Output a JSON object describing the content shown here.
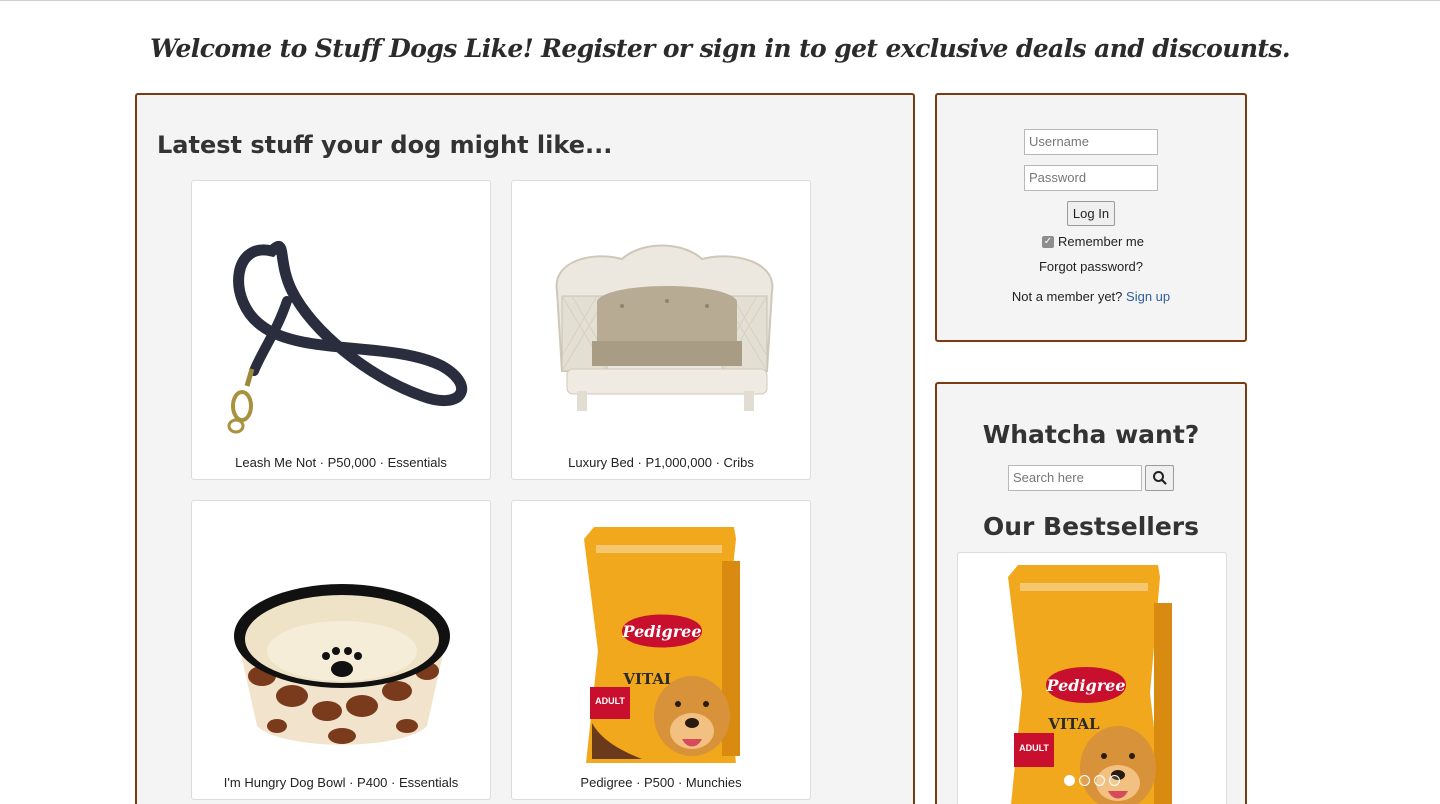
{
  "page": {
    "welcome": "Welcome to Stuff Dogs Like! Register or sign in to get exclusive deals and discounts."
  },
  "main": {
    "heading": "Latest stuff your dog might like...",
    "products": [
      {
        "caption": "Leash Me Not · P50,000 · Essentials",
        "image": "leash-image"
      },
      {
        "caption": "Luxury Bed · P1,000,000 · Cribs",
        "image": "dog-bed-image"
      },
      {
        "caption": "I'm Hungry Dog Bowl · P400 · Essentials",
        "image": "dog-bowl-image"
      },
      {
        "caption": "Pedigree · P500 · Munchies",
        "image": "dog-food-bag-image"
      }
    ]
  },
  "login": {
    "username_placeholder": "Username",
    "password_placeholder": "Password",
    "login_label": "Log In",
    "remember_label": "Remember me",
    "remember_checked": true,
    "forgot_label": "Forgot password?",
    "member_text": "Not a member yet?",
    "signup_label": "Sign up"
  },
  "sidebar": {
    "search_heading": "Whatcha want?",
    "search_placeholder": "Search here",
    "search_icon": "search-icon",
    "bestsellers_heading": "Our Bestsellers",
    "bestseller_image": "dog-food-bag-image",
    "carousel_count": 4,
    "carousel_active": 0
  },
  "colors": {
    "panel_border": "#7a3b12",
    "panel_bg": "#f4f4f4",
    "link": "#2d5f9a",
    "pedigree_yellow": "#f2a81c",
    "pedigree_red": "#c8102e"
  }
}
